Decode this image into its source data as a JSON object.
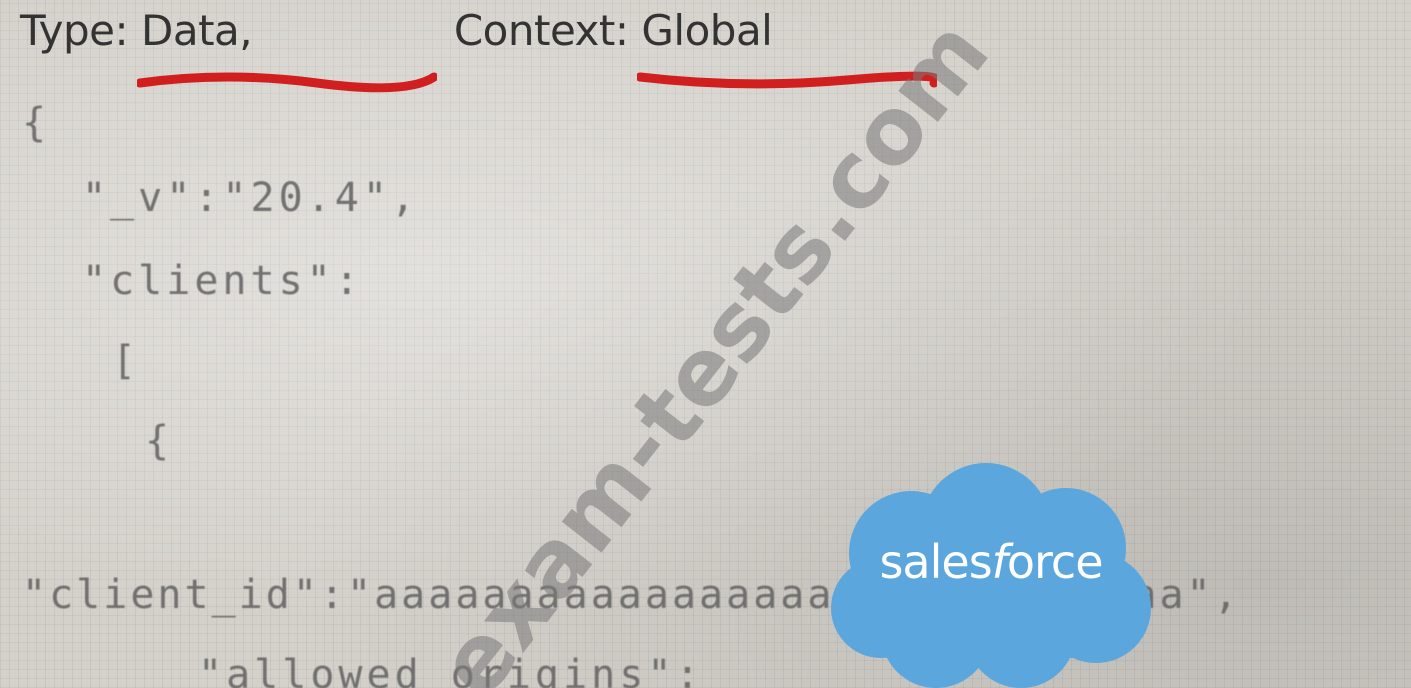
{
  "header": {
    "type_label": "Type: ",
    "type_value": "Data,",
    "context_label": " Context: ",
    "context_value": "Global"
  },
  "code_lines": {
    "open_brace": "{",
    "version": "\"_v\":\"20.4\",",
    "clients": "\"clients\":",
    "array_open": "[",
    "object_open": "{",
    "client_id": "\"client_id\":\"aaaaaaaaaaaaaaaaaaaaaaaaaaaaaa\",",
    "allowed_origins": "\"allowed_origins\":"
  },
  "watermark": {
    "text": "exam-tests.com"
  },
  "logo": {
    "name": "salesforce",
    "text_before": "sales",
    "text_italic": "f",
    "text_after": "orce",
    "cloud_color": "#5aa6dd"
  },
  "colors": {
    "underline": "#d11f1f",
    "header_text": "#333333",
    "code_text": "#666666"
  }
}
